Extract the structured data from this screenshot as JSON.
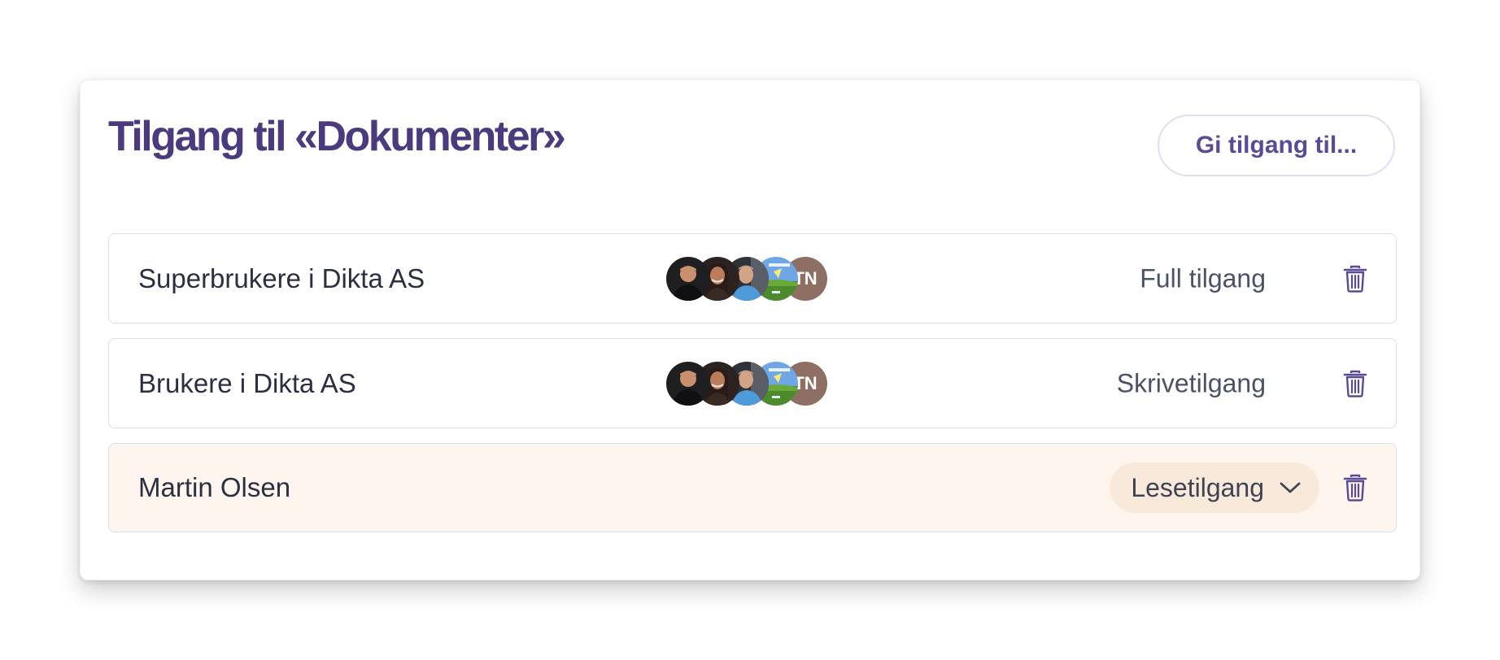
{
  "header": {
    "title": "Tilgang til «Dokumenter»",
    "grant_button_label": "Gi tilgang til..."
  },
  "rows": [
    {
      "name": "Superbrukere i Dikta AS",
      "access": "Full tilgang",
      "avatars_initials": "TN",
      "highlighted": false
    },
    {
      "name": "Brukere i Dikta AS",
      "access": "Skrivetilgang",
      "avatars_initials": "TN",
      "highlighted": false
    },
    {
      "name": "Martin Olsen",
      "access": "Lesetilgang",
      "highlighted": true
    }
  ],
  "icons": {
    "delete": "trash-icon",
    "dropdown": "chevron-down-icon"
  },
  "colors": {
    "title": "#4b3b7e",
    "accent": "#5b4a95",
    "highlight_row": "#fdf5ee",
    "select_bg": "#f9e9da",
    "initials_avatar": "#8e6f63"
  }
}
